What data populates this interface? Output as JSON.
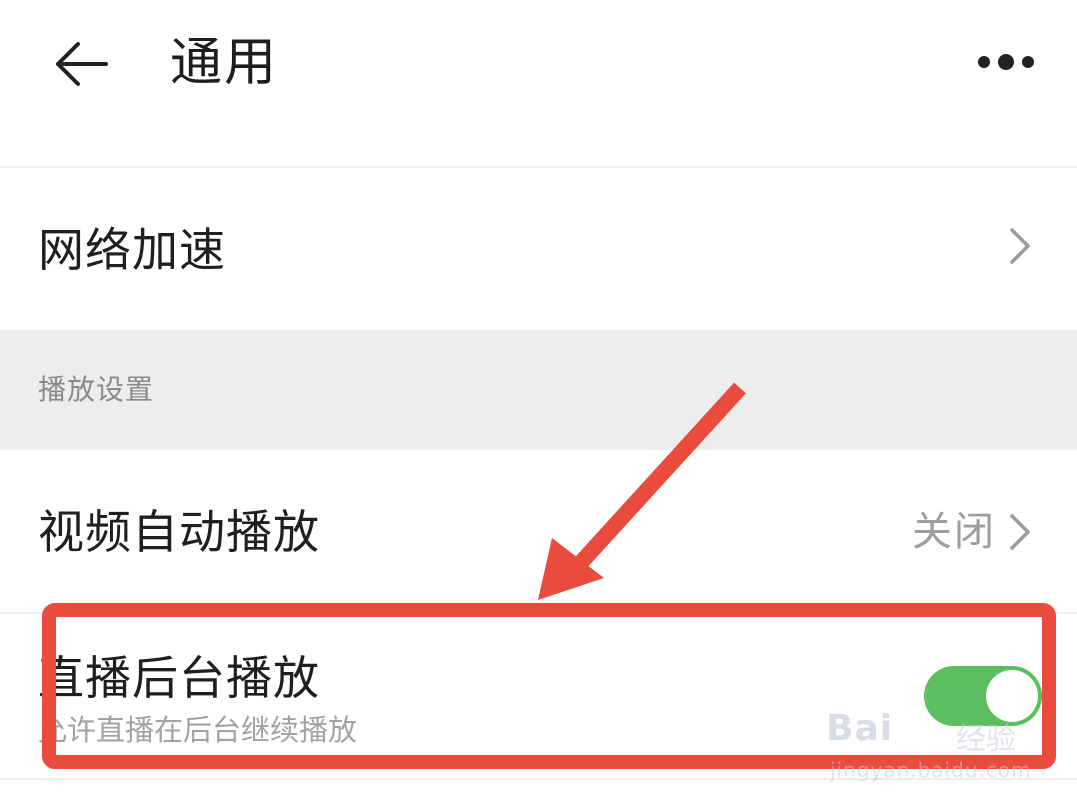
{
  "header": {
    "title": "通用",
    "back_icon": "arrow-left-icon",
    "more_icon": "more-dots-icon"
  },
  "settings": {
    "network": {
      "label": "网络加速",
      "icon": "chevron-right-icon"
    },
    "section": {
      "title": "播放设置"
    },
    "autoplay": {
      "label": "视频自动播放",
      "value": "关闭",
      "icon": "chevron-right-icon"
    },
    "live_background": {
      "label": "直播后台播放",
      "sublabel": "允许直播在后台继续播放",
      "enabled": true
    }
  },
  "watermark": {
    "brand": "Bai",
    "brand_suffix": "经验",
    "url": "jingyan.baidu.com"
  },
  "colors": {
    "toggle_on": "#5bbf60",
    "annotation": "#e94b3c",
    "section_bg": "#ededed"
  }
}
